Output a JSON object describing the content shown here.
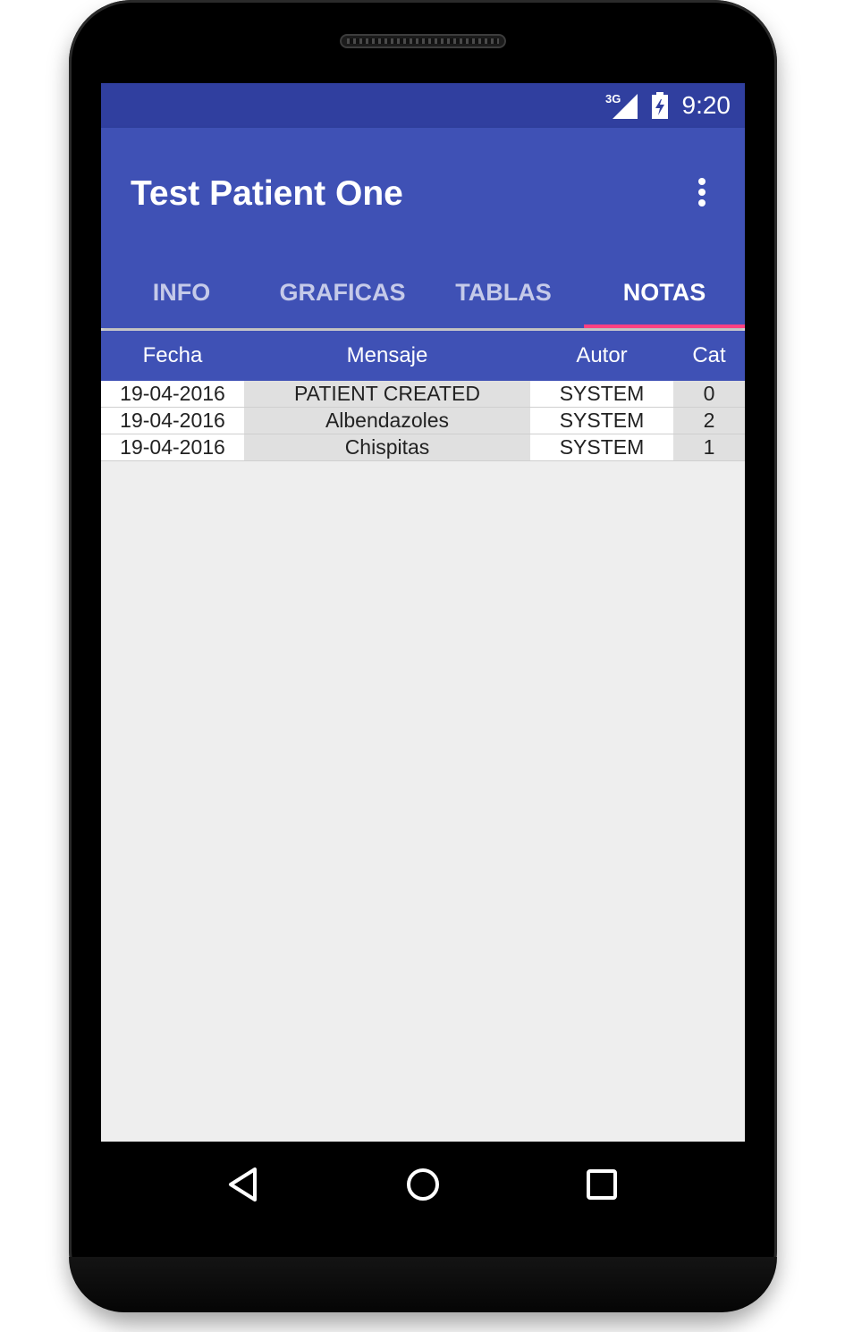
{
  "status_bar": {
    "network_label": "3G",
    "time": "9:20",
    "icons": [
      "signal-icon",
      "battery-charging-icon"
    ]
  },
  "app_bar": {
    "title": "Test Patient One",
    "overflow_icon": "more-vert-icon"
  },
  "tabs": [
    {
      "label": "INFO",
      "active": false
    },
    {
      "label": "GRAFICAS",
      "active": false
    },
    {
      "label": "TABLAS",
      "active": false
    },
    {
      "label": "NOTAS",
      "active": true
    }
  ],
  "table": {
    "columns": [
      "Fecha",
      "Mensaje",
      "Autor",
      "Cat"
    ],
    "rows": [
      {
        "fecha": "19-04-2016",
        "mensaje": "PATIENT CREATED",
        "autor": "SYSTEM",
        "cat": "0"
      },
      {
        "fecha": "19-04-2016",
        "mensaje": "Albendazoles",
        "autor": "SYSTEM",
        "cat": "2"
      },
      {
        "fecha": "19-04-2016",
        "mensaje": "Chispitas",
        "autor": "SYSTEM",
        "cat": "1"
      }
    ]
  },
  "nav_bar": {
    "icons": [
      "back-icon",
      "home-icon",
      "recents-icon"
    ]
  },
  "colors": {
    "primary": "#3f51b5",
    "primary_dark": "#303f9f",
    "accent": "#ff4081"
  }
}
